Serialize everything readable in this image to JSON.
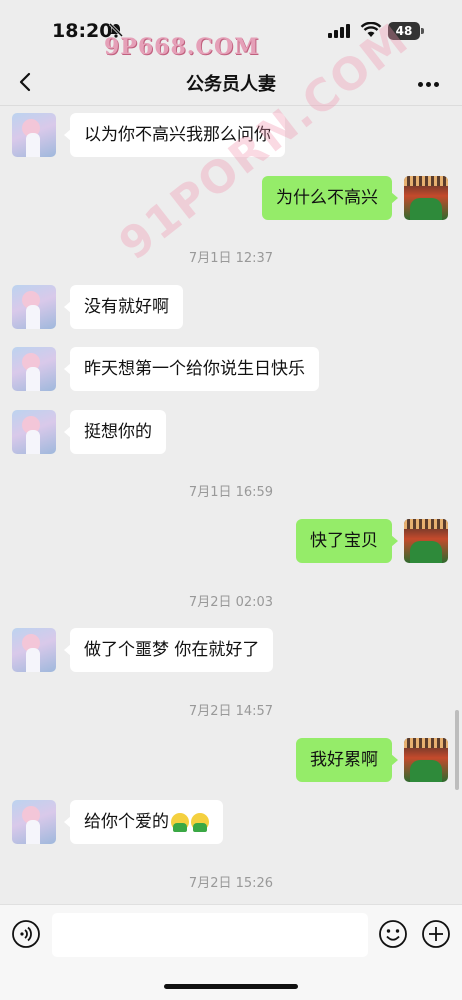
{
  "status_bar": {
    "time": "18:20",
    "battery": "48",
    "watermark": "9P668.COM"
  },
  "watermark_diag": "91PORN.COM",
  "nav": {
    "title": "公务员人妻"
  },
  "messages": [
    {
      "side": "left",
      "text": "以为你不高兴我那么问你"
    },
    {
      "side": "right",
      "text": "为什么不高兴"
    },
    {
      "type": "time",
      "text": "7月1日 12:37"
    },
    {
      "side": "left",
      "text": "没有就好啊"
    },
    {
      "side": "left",
      "text": "昨天想第一个给你说生日快乐"
    },
    {
      "side": "left",
      "text": "挺想你的"
    },
    {
      "type": "time",
      "text": "7月1日 16:59"
    },
    {
      "side": "right",
      "text": "快了宝贝"
    },
    {
      "type": "time",
      "text": "7月2日 02:03"
    },
    {
      "side": "left",
      "text": "做了个噩梦 你在就好了"
    },
    {
      "type": "time",
      "text": "7月2日 14:57"
    },
    {
      "side": "right",
      "text": "我好累啊"
    },
    {
      "side": "left",
      "text": "给你个爱的",
      "emoji_count": 2
    },
    {
      "type": "time",
      "text": "7月2日 15:26"
    }
  ],
  "input": {
    "placeholder": ""
  },
  "colors": {
    "background": "#ededed",
    "bubble_right": "#95ec69",
    "bubble_left": "#ffffff",
    "timestamp": "#999999"
  },
  "icons": [
    "mute-icon",
    "signal-icon",
    "wifi-icon",
    "back-icon",
    "more-icon",
    "voice-icon",
    "emoji-icon",
    "plus-icon"
  ]
}
